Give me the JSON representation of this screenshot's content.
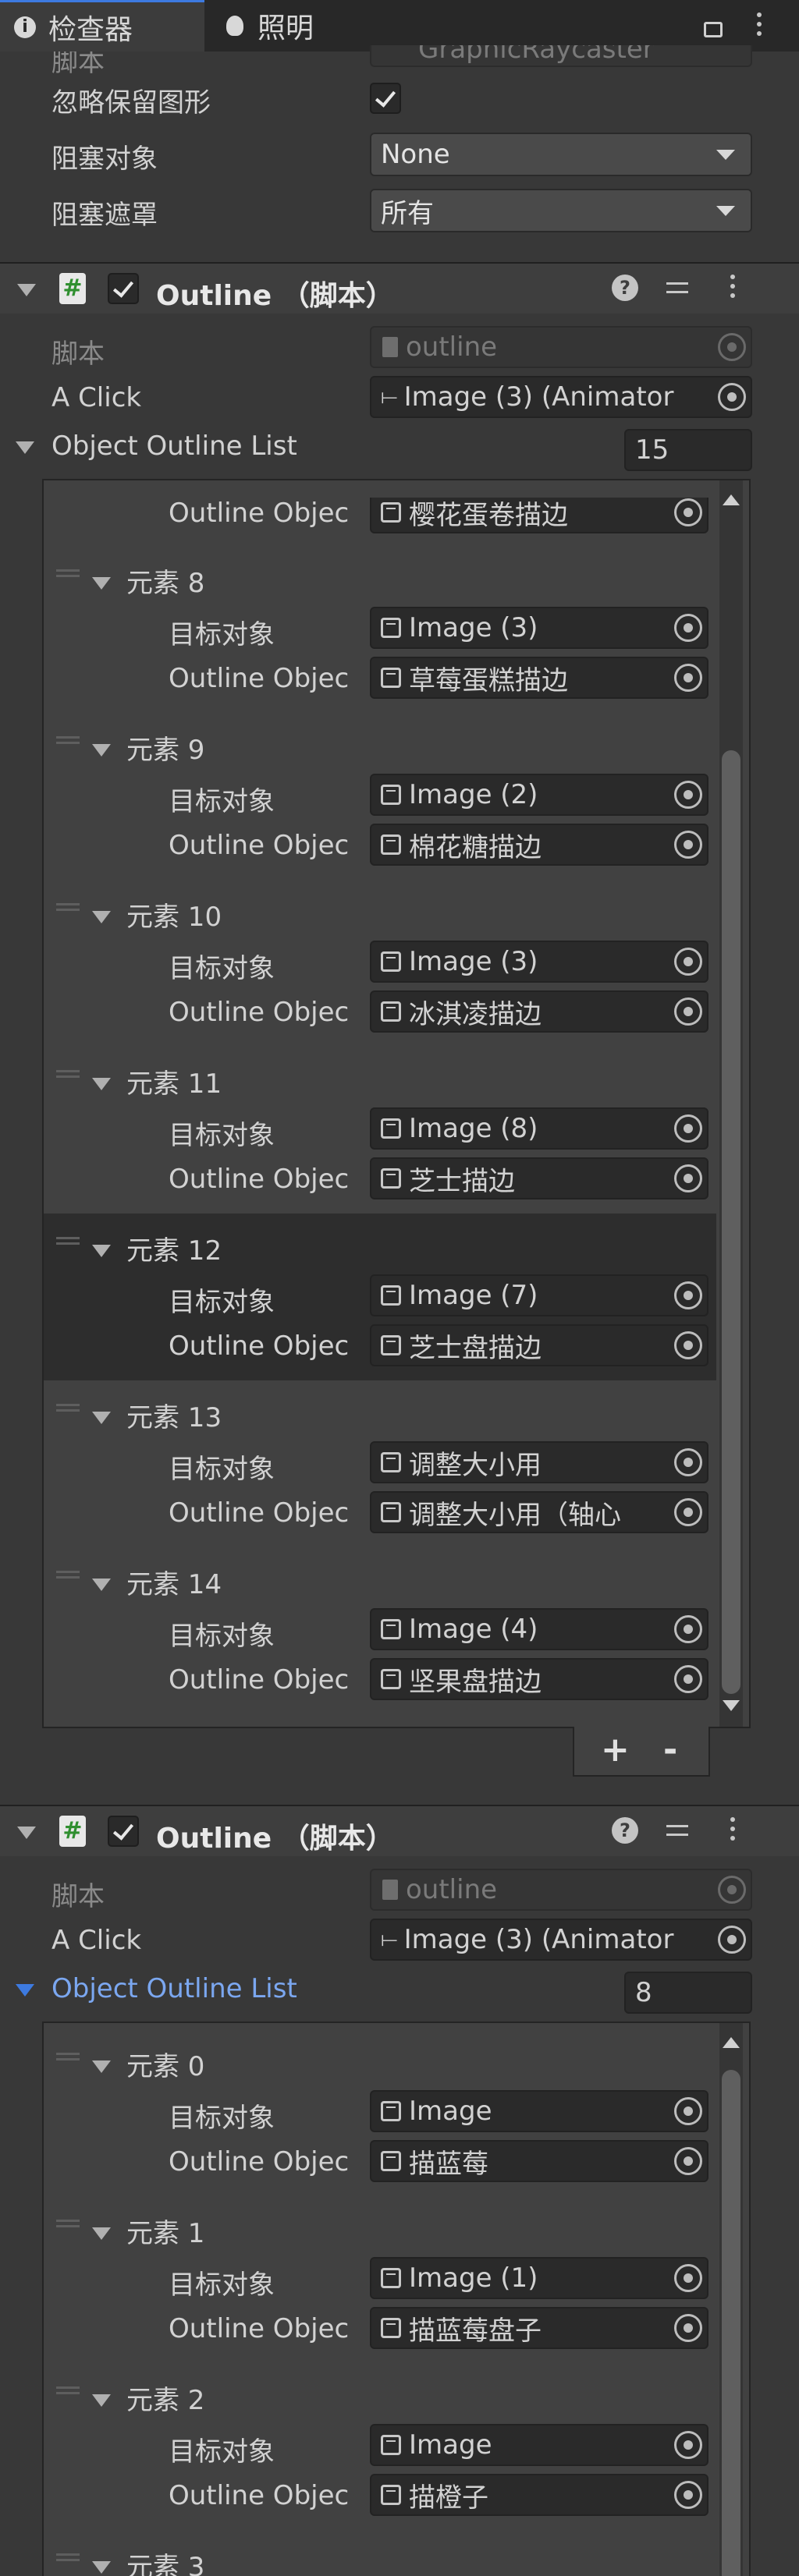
{
  "tabs": {
    "inspector": "检查器",
    "lighting": "照明"
  },
  "top_partial": {
    "script_value": "GraphicRaycaster",
    "script_label": "脚本"
  },
  "props": {
    "ignore_reversed_label": "忽略保留图形",
    "blocking_objects_label": "阻塞对象",
    "blocking_objects_value": "None",
    "blocking_mask_label": "阻塞遮罩",
    "blocking_mask_value": "所有"
  },
  "comp1": {
    "title": "Outline （脚本）",
    "script_label": "脚本",
    "script_value": "outline",
    "aclick_label": "A Click",
    "aclick_value": "Image (3) (Animator",
    "list_label": "Object Outline List",
    "list_count": "15",
    "partial_label": "Outline Objec",
    "partial_value": "樱花蛋卷描边",
    "elements": [
      {
        "name": "元素 8",
        "target_label": "目标对象",
        "target": "Image (3)",
        "outline_label": "Outline Objec",
        "outline": "草莓蛋糕描边"
      },
      {
        "name": "元素 9",
        "target_label": "目标对象",
        "target": "Image (2)",
        "outline_label": "Outline Objec",
        "outline": "棉花糖描边"
      },
      {
        "name": "元素 10",
        "target_label": "目标对象",
        "target": "Image (3)",
        "outline_label": "Outline Objec",
        "outline": "冰淇凌描边"
      },
      {
        "name": "元素 11",
        "target_label": "目标对象",
        "target": "Image (8)",
        "outline_label": "Outline Objec",
        "outline": "芝士描边"
      },
      {
        "name": "元素 12",
        "target_label": "目标对象",
        "target": "Image (7)",
        "outline_label": "Outline Objec",
        "outline": "芝士盘描边"
      },
      {
        "name": "元素 13",
        "target_label": "目标对象",
        "target": "调整大小用",
        "outline_label": "Outline Objec",
        "outline": "调整大小用（轴心"
      },
      {
        "name": "元素 14",
        "target_label": "目标对象",
        "target": "Image (4)",
        "outline_label": "Outline Objec",
        "outline": "坚果盘描边"
      }
    ],
    "plus": "+",
    "minus": "-"
  },
  "comp2": {
    "title": "Outline （脚本）",
    "script_label": "脚本",
    "script_value": "outline",
    "aclick_label": "A Click",
    "aclick_value": "Image (3) (Animator",
    "list_label": "Object Outline List",
    "list_count": "8",
    "elements": [
      {
        "name": "元素 0",
        "target_label": "目标对象",
        "target": "Image",
        "outline_label": "Outline Objec",
        "outline": "描蓝莓"
      },
      {
        "name": "元素 1",
        "target_label": "目标对象",
        "target": "Image (1)",
        "outline_label": "Outline Objec",
        "outline": "描蓝莓盘子"
      },
      {
        "name": "元素 2",
        "target_label": "目标对象",
        "target": "Image",
        "outline_label": "Outline Objec",
        "outline": "描橙子"
      }
    ],
    "partial_element": "元素 3"
  },
  "colors": {
    "accent": "#3d7ae0",
    "list_label_active": "#7ba7f0"
  }
}
